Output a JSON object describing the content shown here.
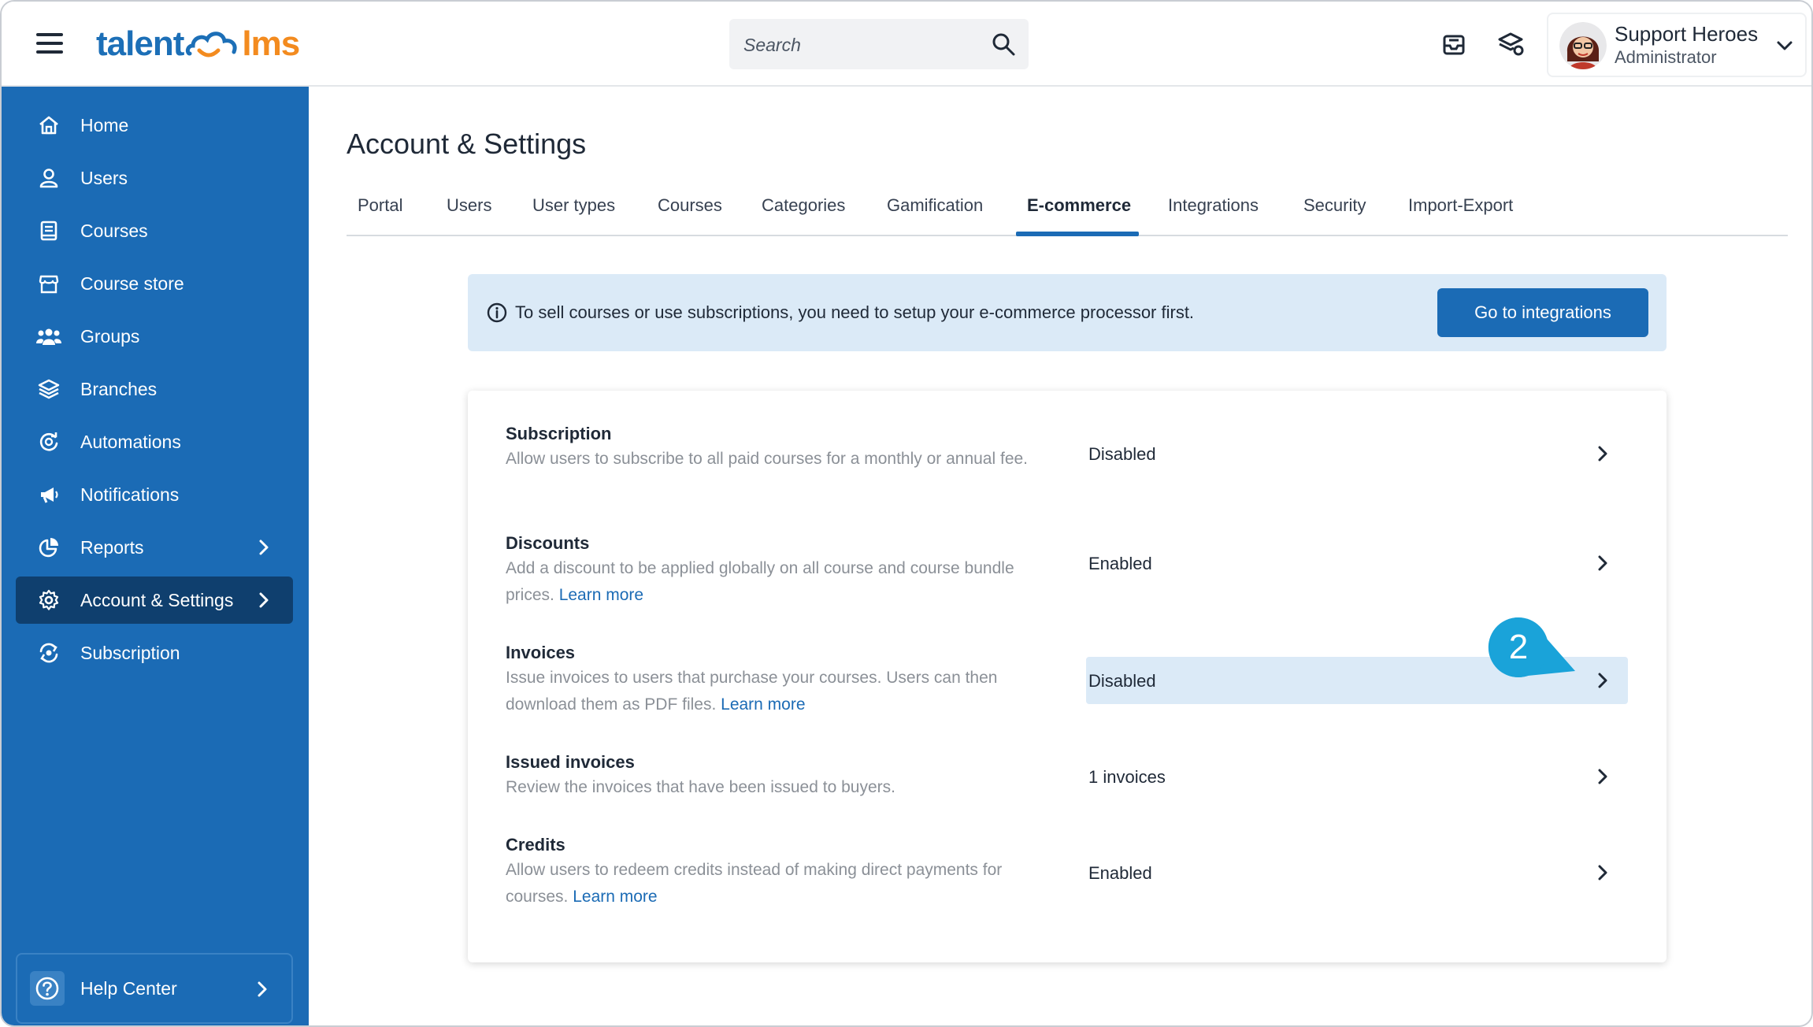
{
  "header": {
    "logo_left": "talent",
    "logo_right": "lms",
    "search_placeholder": "Search",
    "user_name": "Support Heroes",
    "user_role": "Administrator"
  },
  "sidebar": {
    "items": [
      {
        "label": "Home",
        "icon": "home-icon"
      },
      {
        "label": "Users",
        "icon": "user-icon"
      },
      {
        "label": "Courses",
        "icon": "book-icon"
      },
      {
        "label": "Course store",
        "icon": "store-icon"
      },
      {
        "label": "Groups",
        "icon": "groups-icon"
      },
      {
        "label": "Branches",
        "icon": "layers-icon"
      },
      {
        "label": "Automations",
        "icon": "automation-icon"
      },
      {
        "label": "Notifications",
        "icon": "megaphone-icon"
      },
      {
        "label": "Reports",
        "icon": "pie-chart-icon"
      },
      {
        "label": "Account & Settings",
        "icon": "gear-icon"
      },
      {
        "label": "Subscription",
        "icon": "subscription-icon"
      }
    ],
    "help_label": "Help Center"
  },
  "main": {
    "title": "Account & Settings",
    "tabs": [
      "Portal",
      "Users",
      "User types",
      "Courses",
      "Categories",
      "Gamification",
      "E-commerce",
      "Integrations",
      "Security",
      "Import-Export"
    ],
    "active_tab": "E-commerce",
    "banner": {
      "text": "To sell courses or use subscriptions, you need to setup your e-commerce processor first.",
      "button": "Go to integrations"
    },
    "rows": [
      {
        "title": "Subscription",
        "desc": "Allow users to subscribe to all paid courses for a monthly or annual fee.",
        "link": "",
        "status": "Disabled"
      },
      {
        "title": "Discounts",
        "desc": "Add a discount to be applied globally on all course and course bundle prices.",
        "link": "Learn more",
        "status": "Enabled"
      },
      {
        "title": "Invoices",
        "desc": "Issue invoices to users that purchase your courses. Users can then download them as PDF files.",
        "link": "Learn more",
        "status": "Disabled"
      },
      {
        "title": "Issued invoices",
        "desc": "Review the invoices that have been issued to buyers.",
        "link": "",
        "status": "1 invoices"
      },
      {
        "title": "Credits",
        "desc": "Allow users to redeem credits instead of making direct payments for courses.",
        "link": "Learn more",
        "status": "Enabled"
      }
    ],
    "callout_number": "2"
  },
  "colors": {
    "brand_blue": "#1b6bb5",
    "brand_orange": "#f38b1f",
    "sidebar_active": "#0f3f6e",
    "highlight": "#dbeaf7",
    "callout": "#1aa3d9"
  }
}
